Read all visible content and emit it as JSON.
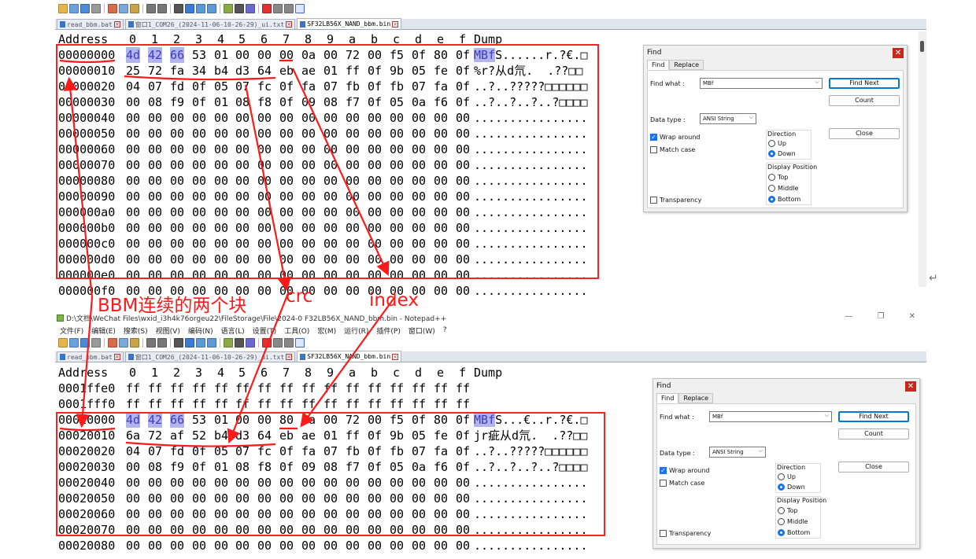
{
  "colors": {
    "annotation": "#ff1a1a",
    "selection": "#b4b4ec",
    "selection_text": "#3c3cc0"
  },
  "top": {
    "tabs": [
      "read_bbm.bat",
      "窗口1_COM26_(2024-11-06-10-26-29)_ui.txt",
      "SF32LB56X_NAND_bbm.bin"
    ],
    "header": {
      "addr": "Address",
      "cols": [
        "0",
        "1",
        "2",
        "3",
        "4",
        "5",
        "6",
        "7",
        "8",
        "9",
        "a",
        "b",
        "c",
        "d",
        "e",
        "f"
      ],
      "dump": "Dump"
    },
    "rows": [
      {
        "addr": "00000000",
        "bytes": [
          "4d",
          "42",
          "66",
          "53",
          "01",
          "00",
          "00",
          "00",
          "0a",
          "00",
          "72",
          "00",
          "f5",
          "0f",
          "80",
          "0f"
        ],
        "sel_dump": "MBf",
        "dump": "S......r.?€.□"
      },
      {
        "addr": "00000010",
        "bytes": [
          "25",
          "72",
          "fa",
          "34",
          "b4",
          "d3",
          "64",
          "eb",
          "ae",
          "01",
          "ff",
          "0f",
          "9b",
          "05",
          "fe",
          "0f"
        ],
        "sel_dump": "",
        "dump": "%r?从d氘.  .??□□"
      },
      {
        "addr": "00000020",
        "bytes": [
          "04",
          "07",
          "fd",
          "0f",
          "05",
          "07",
          "fc",
          "0f",
          "fa",
          "07",
          "fb",
          "0f",
          "fb",
          "07",
          "fa",
          "0f"
        ],
        "sel_dump": "",
        "dump": "..?..?????□□□□□□"
      },
      {
        "addr": "00000030",
        "bytes": [
          "00",
          "08",
          "f9",
          "0f",
          "01",
          "08",
          "f8",
          "0f",
          "09",
          "08",
          "f7",
          "0f",
          "05",
          "0a",
          "f6",
          "0f"
        ],
        "sel_dump": "",
        "dump": "..?..?..?..?□□□□"
      },
      {
        "addr": "00000040",
        "bytes": [
          "00",
          "00",
          "00",
          "00",
          "00",
          "00",
          "00",
          "00",
          "00",
          "00",
          "00",
          "00",
          "00",
          "00",
          "00",
          "00"
        ],
        "sel_dump": "",
        "dump": "................"
      },
      {
        "addr": "00000050",
        "bytes": [
          "00",
          "00",
          "00",
          "00",
          "00",
          "00",
          "00",
          "00",
          "00",
          "00",
          "00",
          "00",
          "00",
          "00",
          "00",
          "00"
        ],
        "sel_dump": "",
        "dump": "................"
      },
      {
        "addr": "00000060",
        "bytes": [
          "00",
          "00",
          "00",
          "00",
          "00",
          "00",
          "00",
          "00",
          "00",
          "00",
          "00",
          "00",
          "00",
          "00",
          "00",
          "00"
        ],
        "sel_dump": "",
        "dump": "................"
      },
      {
        "addr": "00000070",
        "bytes": [
          "00",
          "00",
          "00",
          "00",
          "00",
          "00",
          "00",
          "00",
          "00",
          "00",
          "00",
          "00",
          "00",
          "00",
          "00",
          "00"
        ],
        "sel_dump": "",
        "dump": "................"
      },
      {
        "addr": "00000080",
        "bytes": [
          "00",
          "00",
          "00",
          "00",
          "00",
          "00",
          "00",
          "00",
          "00",
          "00",
          "00",
          "00",
          "00",
          "00",
          "00",
          "00"
        ],
        "sel_dump": "",
        "dump": "................"
      },
      {
        "addr": "00000090",
        "bytes": [
          "00",
          "00",
          "00",
          "00",
          "00",
          "00",
          "00",
          "00",
          "00",
          "00",
          "00",
          "00",
          "00",
          "00",
          "00",
          "00"
        ],
        "sel_dump": "",
        "dump": "................"
      },
      {
        "addr": "000000a0",
        "bytes": [
          "00",
          "00",
          "00",
          "00",
          "00",
          "00",
          "00",
          "00",
          "00",
          "00",
          "00",
          "00",
          "00",
          "00",
          "00",
          "00"
        ],
        "sel_dump": "",
        "dump": "................"
      },
      {
        "addr": "000000b0",
        "bytes": [
          "00",
          "00",
          "00",
          "00",
          "00",
          "00",
          "00",
          "00",
          "00",
          "00",
          "00",
          "00",
          "00",
          "00",
          "00",
          "00"
        ],
        "sel_dump": "",
        "dump": "................"
      },
      {
        "addr": "000000c0",
        "bytes": [
          "00",
          "00",
          "00",
          "00",
          "00",
          "00",
          "00",
          "00",
          "00",
          "00",
          "00",
          "00",
          "00",
          "00",
          "00",
          "00"
        ],
        "sel_dump": "",
        "dump": "................"
      },
      {
        "addr": "000000d0",
        "bytes": [
          "00",
          "00",
          "00",
          "00",
          "00",
          "00",
          "00",
          "00",
          "00",
          "00",
          "00",
          "00",
          "00",
          "00",
          "00",
          "00"
        ],
        "sel_dump": "",
        "dump": "................"
      },
      {
        "addr": "000000e0",
        "bytes": [
          "00",
          "00",
          "00",
          "00",
          "00",
          "00",
          "00",
          "00",
          "00",
          "00",
          "00",
          "00",
          "00",
          "00",
          "00",
          "00"
        ],
        "sel_dump": "",
        "dump": "................"
      },
      {
        "addr": "000000f0",
        "bytes": [
          "00",
          "00",
          "00",
          "00",
          "00",
          "00",
          "00",
          "00",
          "00",
          "00",
          "00",
          "00",
          "00",
          "00",
          "00",
          "00"
        ],
        "sel_dump": "",
        "dump": "................"
      }
    ]
  },
  "bottom": {
    "window_title": "D:\\文档\\WeChat Files\\wxid_i3h4k76orgeu22\\FileStorage\\File\\2024-0 F32LB56X_NAND_bbm.bin - Notepad++",
    "window_controls": "— ❐ ✕",
    "menu": [
      "文件(F)",
      "编辑(E)",
      "搜索(S)",
      "视图(V)",
      "编码(N)",
      "语言(L)",
      "设置(T)",
      "工具(O)",
      "宏(M)",
      "运行(R)",
      "插件(P)",
      "窗口(W)",
      "?"
    ],
    "tabs": [
      "read_bbm.bat",
      "窗口1_COM26_(2024-11-06-10-26-29)_ui.txt",
      "SF32LB56X_NAND_bbm.bin"
    ],
    "header": {
      "addr": "Address",
      "cols": [
        "0",
        "1",
        "2",
        "3",
        "4",
        "5",
        "6",
        "7",
        "8",
        "9",
        "a",
        "b",
        "c",
        "d",
        "e",
        "f"
      ],
      "dump": "Dump"
    },
    "rows": [
      {
        "addr": "0001ffe0",
        "bytes": [
          "ff",
          "ff",
          "ff",
          "ff",
          "ff",
          "ff",
          "ff",
          "ff",
          "ff",
          "ff",
          "ff",
          "ff",
          "ff",
          "ff",
          "ff",
          "ff"
        ],
        "sel_dump": "",
        "dump": ""
      },
      {
        "addr": "0001fff0",
        "bytes": [
          "ff",
          "ff",
          "ff",
          "ff",
          "ff",
          "ff",
          "ff",
          "ff",
          "ff",
          "ff",
          "ff",
          "ff",
          "ff",
          "ff",
          "ff",
          "ff"
        ],
        "sel_dump": "",
        "dump": ""
      },
      {
        "addr": "00020000",
        "bytes": [
          "4d",
          "42",
          "66",
          "53",
          "01",
          "00",
          "00",
          "80",
          "0a",
          "00",
          "72",
          "00",
          "f5",
          "0f",
          "80",
          "0f"
        ],
        "sel_dump": "MBf",
        "dump": "S...€..r.?€.□"
      },
      {
        "addr": "00020010",
        "bytes": [
          "6a",
          "72",
          "af",
          "52",
          "b4",
          "d3",
          "64",
          "eb",
          "ae",
          "01",
          "ff",
          "0f",
          "9b",
          "05",
          "fe",
          "0f"
        ],
        "sel_dump": "",
        "dump": "jr疵从d氘.  .??□□"
      },
      {
        "addr": "00020020",
        "bytes": [
          "04",
          "07",
          "fd",
          "0f",
          "05",
          "07",
          "fc",
          "0f",
          "fa",
          "07",
          "fb",
          "0f",
          "fb",
          "07",
          "fa",
          "0f"
        ],
        "sel_dump": "",
        "dump": "..?..?????□□□□□□"
      },
      {
        "addr": "00020030",
        "bytes": [
          "00",
          "08",
          "f9",
          "0f",
          "01",
          "08",
          "f8",
          "0f",
          "09",
          "08",
          "f7",
          "0f",
          "05",
          "0a",
          "f6",
          "0f"
        ],
        "sel_dump": "",
        "dump": "..?..?..?..?□□□□"
      },
      {
        "addr": "00020040",
        "bytes": [
          "00",
          "00",
          "00",
          "00",
          "00",
          "00",
          "00",
          "00",
          "00",
          "00",
          "00",
          "00",
          "00",
          "00",
          "00",
          "00"
        ],
        "sel_dump": "",
        "dump": "................"
      },
      {
        "addr": "00020050",
        "bytes": [
          "00",
          "00",
          "00",
          "00",
          "00",
          "00",
          "00",
          "00",
          "00",
          "00",
          "00",
          "00",
          "00",
          "00",
          "00",
          "00"
        ],
        "sel_dump": "",
        "dump": "................"
      },
      {
        "addr": "00020060",
        "bytes": [
          "00",
          "00",
          "00",
          "00",
          "00",
          "00",
          "00",
          "00",
          "00",
          "00",
          "00",
          "00",
          "00",
          "00",
          "00",
          "00"
        ],
        "sel_dump": "",
        "dump": "................"
      },
      {
        "addr": "00020070",
        "bytes": [
          "00",
          "00",
          "00",
          "00",
          "00",
          "00",
          "00",
          "00",
          "00",
          "00",
          "00",
          "00",
          "00",
          "00",
          "00",
          "00"
        ],
        "sel_dump": "",
        "dump": "................"
      },
      {
        "addr": "00020080",
        "bytes": [
          "00",
          "00",
          "00",
          "00",
          "00",
          "00",
          "00",
          "00",
          "00",
          "00",
          "00",
          "00",
          "00",
          "00",
          "00",
          "00"
        ],
        "sel_dump": "",
        "dump": "................"
      }
    ]
  },
  "find": {
    "title": "Find",
    "close": "✕",
    "tabs": [
      "Find",
      "Replace"
    ],
    "find_what_label": "Find what :",
    "find_what_value": "MBf",
    "find_next": "Find Next",
    "count": "Count",
    "data_type_label": "Data type :",
    "data_type_value": "ANSI String",
    "close_button": "Close",
    "wrap_around": "Wrap around",
    "match_case": "Match case",
    "transparency": "Transparency",
    "direction_label": "Direction",
    "dir_up": "Up",
    "dir_down": "Down",
    "display_pos_label": "Display Position",
    "pos_top": "Top",
    "pos_middle": "Middle",
    "pos_bottom": "Bottom",
    "dropdown_glyph": "⌵"
  },
  "annotations": {
    "bbm": "BBM连续的两个块",
    "crc": "crc",
    "index": "index"
  },
  "icons": [
    "save-icon",
    "open-icon",
    "close-icon",
    "print-icon",
    "cut-icon",
    "copy-icon",
    "paste-icon",
    "undo-icon",
    "redo-icon",
    "find-icon",
    "replace-icon",
    "zoom-in-icon",
    "zoom-out-icon",
    "sync-icon",
    "wrap-icon",
    "indent-icon",
    "record-macro-icon",
    "stop-macro-icon",
    "play-macro-icon",
    "hex-icon"
  ],
  "return_mark": "↵"
}
